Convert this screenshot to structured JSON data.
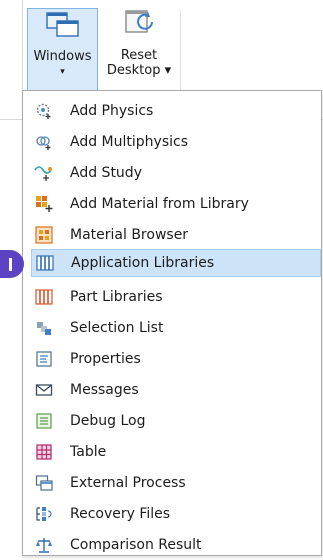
{
  "ribbon": {
    "windows": {
      "label": "Windows",
      "caret": "▾",
      "icon": "windows-icon"
    },
    "reset": {
      "label_line1": "Reset",
      "label_line2": "Desktop ▾",
      "icon": "reset-desktop-icon"
    }
  },
  "menu": {
    "items": [
      {
        "label": "Add Physics",
        "icon": "add-physics-icon"
      },
      {
        "label": "Add Multiphysics",
        "icon": "add-multiphysics-icon"
      },
      {
        "label": "Add Study",
        "icon": "add-study-icon"
      },
      {
        "label": "Add Material from Library",
        "icon": "add-material-icon"
      },
      {
        "label": "Material Browser",
        "icon": "material-browser-icon"
      },
      {
        "label": "Application Libraries",
        "icon": "application-libraries-icon",
        "highlighted": true
      },
      {
        "label": "Part Libraries",
        "icon": "part-libraries-icon"
      },
      {
        "label": "Selection List",
        "icon": "selection-list-icon"
      },
      {
        "label": "Properties",
        "icon": "properties-icon"
      },
      {
        "label": "Messages",
        "icon": "messages-icon"
      },
      {
        "label": "Debug Log",
        "icon": "debug-log-icon"
      },
      {
        "label": "Table",
        "icon": "table-icon"
      },
      {
        "label": "External Process",
        "icon": "external-process-icon"
      },
      {
        "label": "Recovery Files",
        "icon": "recovery-files-icon"
      },
      {
        "label": "Comparison Result",
        "icon": "comparison-result-icon"
      }
    ]
  },
  "colors": {
    "highlight": "#cde3f7",
    "marker": "#5b43c4",
    "ribbon_selected": "#d8e9f9"
  }
}
